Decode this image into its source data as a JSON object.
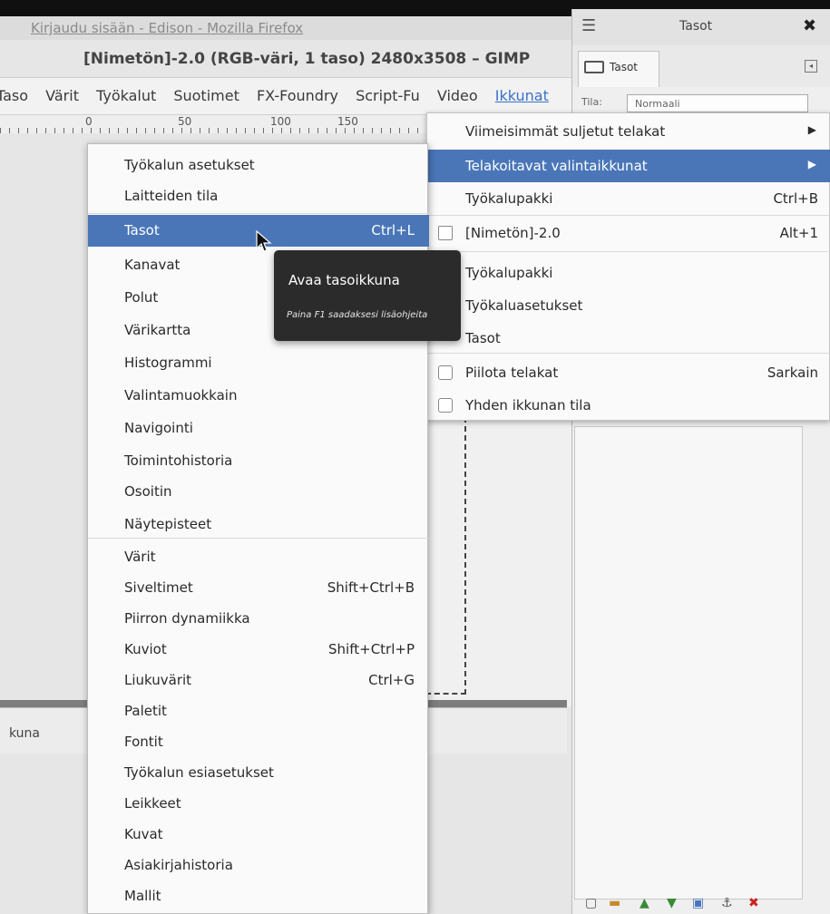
{
  "firefox": {
    "title": "Kirjaudu sisään - Edison - Mozilla Firefox"
  },
  "gimp": {
    "title": "[Nimetön]-2.0 (RGB-väri, 1 taso) 2480x3508 – GIMP",
    "menubar": [
      "Taso",
      "Värit",
      "Työkalut",
      "Suotimet",
      "FX-Foundry",
      "Script-Fu",
      "Video",
      "Ikkunat"
    ],
    "ruler_labels": [
      "0",
      "50",
      "100",
      "150"
    ],
    "status_label": "kuna"
  },
  "layers_dock": {
    "title": "Tasot",
    "tab_label": "Tasot",
    "mode_label": "Tila:",
    "mode_value": "Normaali"
  },
  "window_menu": {
    "items": [
      {
        "label": "Viimeisimmät suljetut telakat",
        "shortcut": "",
        "arrow": "▶"
      },
      {
        "label": "Telakoitavat valintaikkunat",
        "shortcut": "",
        "arrow": "▶"
      },
      {
        "label": "Työkalupakki",
        "shortcut": "Ctrl+B"
      },
      {
        "label": "[Nimetön]-2.0",
        "shortcut": "Alt+1"
      },
      {
        "label": "Työkalupakki",
        "shortcut": ""
      },
      {
        "label": "Työkaluasetukset",
        "shortcut": ""
      },
      {
        "label": "Tasot",
        "shortcut": ""
      },
      {
        "label": "Piilota telakat",
        "shortcut": "Sarkain"
      },
      {
        "label": "Yhden ikkunan tila",
        "shortcut": ""
      }
    ]
  },
  "dialogs_menu": {
    "items": [
      {
        "label": "Työkalun asetukset",
        "shortcut": ""
      },
      {
        "label": "Laitteiden tila",
        "shortcut": ""
      },
      {
        "label": "Tasot",
        "shortcut": "Ctrl+L"
      },
      {
        "label": "Kanavat",
        "shortcut": ""
      },
      {
        "label": "Polut",
        "shortcut": ""
      },
      {
        "label": "Värikartta",
        "shortcut": ""
      },
      {
        "label": "Histogrammi",
        "shortcut": ""
      },
      {
        "label": "Valintamuokkain",
        "shortcut": ""
      },
      {
        "label": "Navigointi",
        "shortcut": ""
      },
      {
        "label": "Toimintohistoria",
        "shortcut": ""
      },
      {
        "label": "Osoitin",
        "shortcut": ""
      },
      {
        "label": "Näytepisteet",
        "shortcut": ""
      },
      {
        "label": "Värit",
        "shortcut": ""
      },
      {
        "label": "Siveltimet",
        "shortcut": "Shift+Ctrl+B"
      },
      {
        "label": "Piirron dynamiikka",
        "shortcut": ""
      },
      {
        "label": "Kuviot",
        "shortcut": "Shift+Ctrl+P"
      },
      {
        "label": "Liukuvärit",
        "shortcut": "Ctrl+G"
      },
      {
        "label": "Paletit",
        "shortcut": ""
      },
      {
        "label": "Fontit",
        "shortcut": ""
      },
      {
        "label": "Työkalun esiasetukset",
        "shortcut": ""
      },
      {
        "label": "Leikkeet",
        "shortcut": ""
      },
      {
        "label": "Kuvat",
        "shortcut": ""
      },
      {
        "label": "Asiakirjahistoria",
        "shortcut": ""
      },
      {
        "label": "Mallit",
        "shortcut": ""
      }
    ]
  },
  "tooltip": {
    "title": "Avaa tasoikkuna",
    "hint": "Paina F1 saadaksesi lisäohjeita"
  },
  "colors": {
    "highlight": "#4a76b8",
    "tooltip_bg": "#2b2b2b",
    "active_menu": "#3c72c9"
  }
}
